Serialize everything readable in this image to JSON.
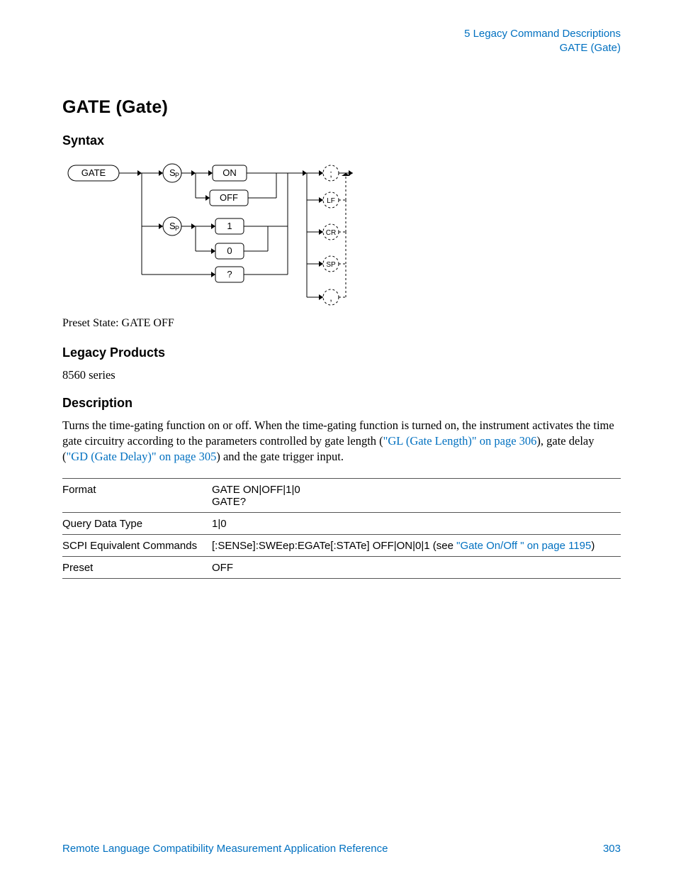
{
  "header": {
    "chapter": "5  Legacy Command Descriptions",
    "section": "GATE (Gate)"
  },
  "title": "GATE (Gate)",
  "syntax_heading": "Syntax",
  "diagram": {
    "cmd": "GATE",
    "sp1": "S",
    "sp1_sub": "P",
    "on": "ON",
    "off": "OFF",
    "sp2": "S",
    "sp2_sub": "P",
    "one": "1",
    "zero": "0",
    "qmark": "?",
    "semi": ";",
    "lf": "LF",
    "cr": "CR",
    "sp": "SP",
    "comma": ","
  },
  "preset_state": "Preset State: GATE OFF",
  "legacy_heading": "Legacy Products",
  "legacy_body": "8560 series",
  "description_heading": "Description",
  "description": {
    "pre1": "Turns the time-gating function on or off. When the time-gating function is turned on, the instrument activates the time gate circuitry according to the parameters controlled by gate length (",
    "link1": "\"GL (Gate Length)\" on page 306",
    "mid": "), gate delay (",
    "link2": "\"GD (Gate Delay)\" on page 305",
    "post": ") and the gate trigger input."
  },
  "table": {
    "rows": [
      {
        "label": "Format",
        "value_lines": [
          "GATE ON|OFF|1|0",
          "GATE?"
        ]
      },
      {
        "label": "Query Data Type",
        "value_lines": [
          "1|0"
        ]
      },
      {
        "label": "SCPI Equivalent Commands",
        "prefix": "[:SENSe]:SWEep:EGATe[:STATe] OFF|ON|0|1 (see ",
        "link": "\"Gate On/Off \" on page 1195",
        "suffix": ")"
      },
      {
        "label": "Preset",
        "value_lines": [
          "OFF"
        ]
      }
    ]
  },
  "footer": {
    "doc": "Remote Language Compatibility Measurement Application Reference",
    "page": "303"
  }
}
